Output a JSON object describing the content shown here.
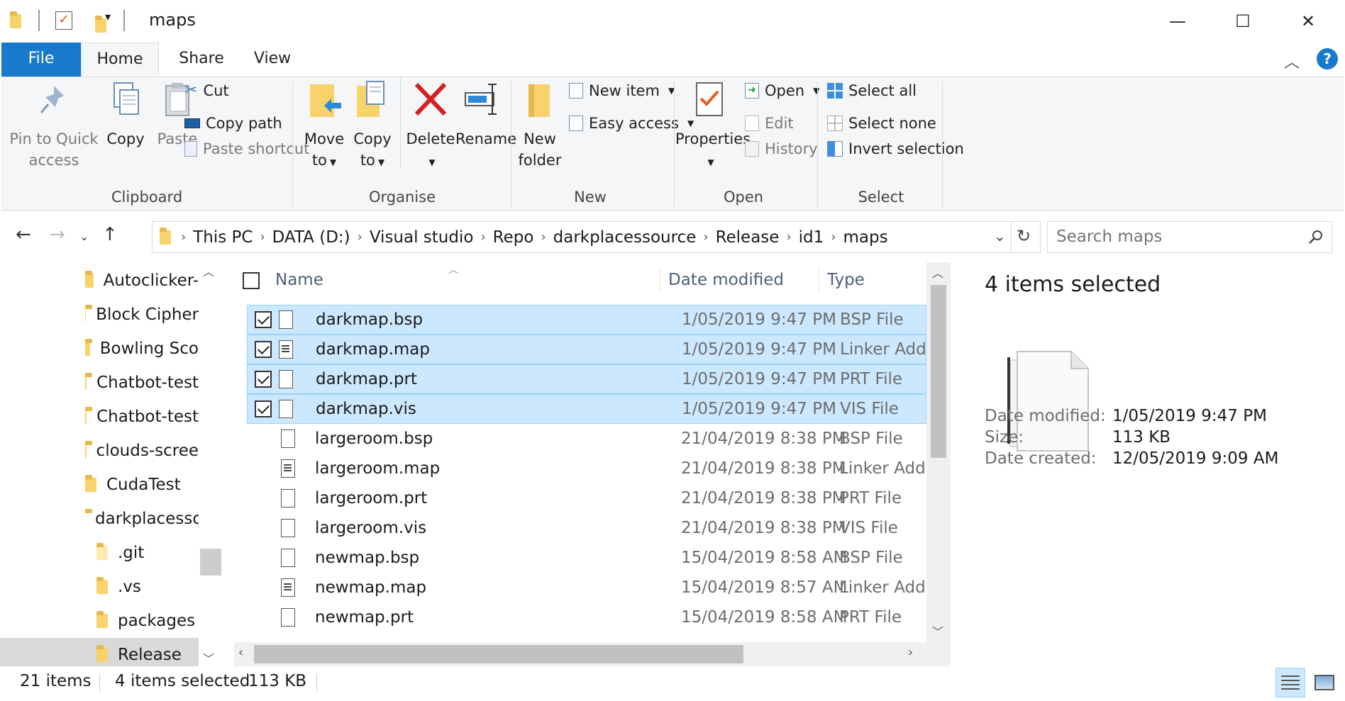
{
  "window": {
    "title": "maps",
    "controls": {
      "minimize": "—",
      "maximize": "☐",
      "close": "✕"
    }
  },
  "ribbon_tabs": [
    "File",
    "Home",
    "Share",
    "View"
  ],
  "ribbon": {
    "clipboard": {
      "label": "Clipboard",
      "pin": "Pin to Quick access",
      "pin_l1": "Pin to Quick",
      "pin_l2": "access",
      "copy": "Copy",
      "paste": "Paste",
      "cut": "Cut",
      "copy_path": "Copy path",
      "paste_shortcut": "Paste shortcut"
    },
    "organise": {
      "label": "Organise",
      "move_l1": "Move",
      "move_l2": "to",
      "copy_l1": "Copy",
      "copy_l2": "to",
      "delete": "Delete",
      "rename": "Rename"
    },
    "new": {
      "label": "New",
      "folder_l1": "New",
      "folder_l2": "folder",
      "new_item": "New item",
      "easy_access": "Easy access"
    },
    "open": {
      "label": "Open",
      "properties": "Properties",
      "open": "Open",
      "edit": "Edit",
      "history": "History"
    },
    "select": {
      "label": "Select",
      "select_all": "Select all",
      "select_none": "Select none",
      "invert": "Invert selection"
    }
  },
  "breadcrumb": [
    "This PC",
    "DATA (D:)",
    "Visual studio",
    "Repo",
    "darkplacessource",
    "Release",
    "id1",
    "maps"
  ],
  "search": {
    "placeholder": "Search maps"
  },
  "nav_items": [
    {
      "label": "Autoclicker-",
      "indent": 0
    },
    {
      "label": "Block Cipher",
      "indent": 0
    },
    {
      "label": "Bowling Sco",
      "indent": 0
    },
    {
      "label": "Chatbot-test",
      "indent": 0
    },
    {
      "label": "Chatbot-test",
      "indent": 0
    },
    {
      "label": "clouds-scree",
      "indent": 0
    },
    {
      "label": "CudaTest",
      "indent": 0
    },
    {
      "label": "darkplacesso",
      "indent": 0
    },
    {
      "label": ".git",
      "indent": 1
    },
    {
      "label": ".vs",
      "indent": 1
    },
    {
      "label": "packages",
      "indent": 1
    },
    {
      "label": "Release",
      "indent": 1,
      "selected": true
    }
  ],
  "columns": {
    "name": "Name",
    "date": "Date modified",
    "type": "Type"
  },
  "files": [
    {
      "name": "darkmap.bsp",
      "date": "1/05/2019 9:47 PM",
      "type": "BSP File",
      "selected": true,
      "icon": "blank"
    },
    {
      "name": "darkmap.map",
      "date": "1/05/2019 9:47 PM",
      "type": "Linker Address Map",
      "selected": true,
      "icon": "text"
    },
    {
      "name": "darkmap.prt",
      "date": "1/05/2019 9:47 PM",
      "type": "PRT File",
      "selected": true,
      "icon": "blank"
    },
    {
      "name": "darkmap.vis",
      "date": "1/05/2019 9:47 PM",
      "type": "VIS File",
      "selected": true,
      "icon": "blank"
    },
    {
      "name": "largeroom.bsp",
      "date": "21/04/2019 8:38 PM",
      "type": "BSP File",
      "selected": false,
      "icon": "blank"
    },
    {
      "name": "largeroom.map",
      "date": "21/04/2019 8:38 PM",
      "type": "Linker Address Map",
      "selected": false,
      "icon": "text"
    },
    {
      "name": "largeroom.prt",
      "date": "21/04/2019 8:38 PM",
      "type": "PRT File",
      "selected": false,
      "icon": "blank"
    },
    {
      "name": "largeroom.vis",
      "date": "21/04/2019 8:38 PM",
      "type": "VIS File",
      "selected": false,
      "icon": "blank"
    },
    {
      "name": "newmap.bsp",
      "date": "15/04/2019 8:58 AM",
      "type": "BSP File",
      "selected": false,
      "icon": "blank"
    },
    {
      "name": "newmap.map",
      "date": "15/04/2019 8:57 AM",
      "type": "Linker Address Map",
      "selected": false,
      "icon": "text"
    },
    {
      "name": "newmap.prt",
      "date": "15/04/2019 8:58 AM",
      "type": "PRT File",
      "selected": false,
      "icon": "blank"
    }
  ],
  "details": {
    "title": "4 items selected",
    "date_modified_label": "Date modified:",
    "date_modified": "1/05/2019 9:47 PM",
    "size_label": "Size:",
    "size": "113 KB",
    "date_created_label": "Date created:",
    "date_created": "12/05/2019 9:09 AM"
  },
  "status": {
    "count": "21 items",
    "selected": "4 items selected",
    "size": "113 KB"
  },
  "colors": {
    "accent": "#1979ca",
    "selection": "#cce8ff",
    "selection_border": "#99d1ff",
    "folder": "#f8d26a"
  }
}
